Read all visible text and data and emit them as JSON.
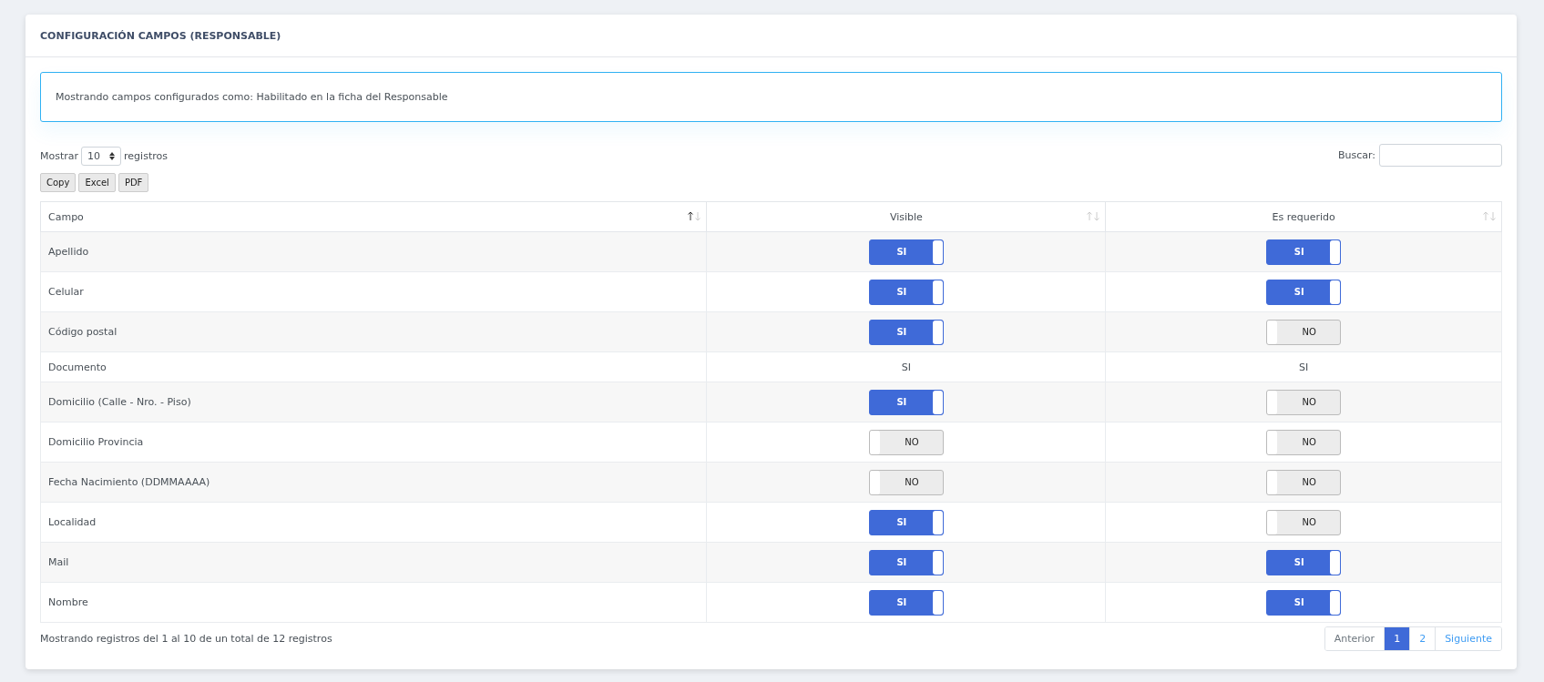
{
  "card": {
    "title": "CONFIGURACIÓN CAMPOS (RESPONSABLE)"
  },
  "alert": {
    "text": "Mostrando campos configurados como: Habilitado en la ficha del Responsable"
  },
  "length": {
    "before": "Mostrar",
    "value": "10",
    "after": "registros"
  },
  "search": {
    "label": "Buscar:"
  },
  "export_buttons": [
    "Copy",
    "Excel",
    "PDF"
  ],
  "table": {
    "columns": [
      {
        "label": "Campo",
        "sorted": true
      },
      {
        "label": "Visible",
        "sorted": false
      },
      {
        "label": "Es requerido",
        "sorted": false
      }
    ],
    "rows": [
      {
        "field": "Apellido",
        "visible": {
          "kind": "toggle",
          "on": true,
          "label": "SI"
        },
        "required": {
          "kind": "toggle",
          "on": true,
          "label": "SI"
        }
      },
      {
        "field": "Celular",
        "visible": {
          "kind": "toggle",
          "on": true,
          "label": "SI"
        },
        "required": {
          "kind": "toggle",
          "on": true,
          "label": "SI"
        }
      },
      {
        "field": "Código postal",
        "visible": {
          "kind": "toggle",
          "on": true,
          "label": "SI"
        },
        "required": {
          "kind": "toggle",
          "on": false,
          "label": "NO"
        }
      },
      {
        "field": "Documento",
        "visible": {
          "kind": "text",
          "label": "SI"
        },
        "required": {
          "kind": "text",
          "label": "SI"
        }
      },
      {
        "field": "Domicilio (Calle - Nro. - Piso)",
        "visible": {
          "kind": "toggle",
          "on": true,
          "label": "SI"
        },
        "required": {
          "kind": "toggle",
          "on": false,
          "label": "NO"
        }
      },
      {
        "field": "Domicilio Provincia",
        "visible": {
          "kind": "toggle",
          "on": false,
          "label": "NO"
        },
        "required": {
          "kind": "toggle",
          "on": false,
          "label": "NO"
        }
      },
      {
        "field": "Fecha Nacimiento (DDMMAAAA)",
        "visible": {
          "kind": "toggle",
          "on": false,
          "label": "NO"
        },
        "required": {
          "kind": "toggle",
          "on": false,
          "label": "NO"
        }
      },
      {
        "field": "Localidad",
        "visible": {
          "kind": "toggle",
          "on": true,
          "label": "SI"
        },
        "required": {
          "kind": "toggle",
          "on": false,
          "label": "NO"
        }
      },
      {
        "field": "Mail",
        "visible": {
          "kind": "toggle",
          "on": true,
          "label": "SI"
        },
        "required": {
          "kind": "toggle",
          "on": true,
          "label": "SI"
        }
      },
      {
        "field": "Nombre",
        "visible": {
          "kind": "toggle",
          "on": true,
          "label": "SI"
        },
        "required": {
          "kind": "toggle",
          "on": true,
          "label": "SI"
        }
      }
    ]
  },
  "info": "Mostrando registros del 1 al 10 de un total de 12 registros",
  "pagination": [
    {
      "label": "Anterior",
      "selected": false,
      "disabled": true
    },
    {
      "label": "1",
      "selected": true,
      "disabled": false
    },
    {
      "label": "2",
      "selected": false,
      "disabled": false
    },
    {
      "label": "Siguiente",
      "selected": false,
      "disabled": false
    }
  ]
}
